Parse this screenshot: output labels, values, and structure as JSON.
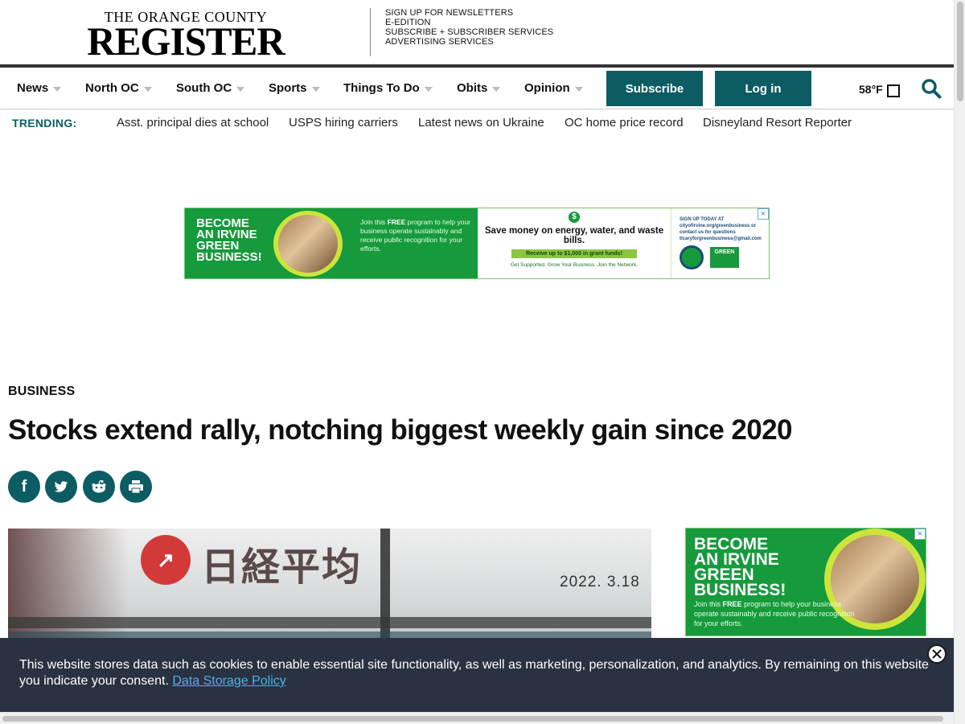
{
  "masthead": {
    "logo_small": "THE ORANGE COUNTY",
    "logo_big": "REGISTER",
    "links": [
      "SIGN UP FOR NEWSLETTERS",
      "E-EDITION",
      "SUBSCRIBE + SUBSCRIBER SERVICES",
      "ADVERTISING SERVICES"
    ]
  },
  "nav": {
    "items": [
      "News",
      "North OC",
      "South OC",
      "Sports",
      "Things To Do",
      "Obits",
      "Opinion"
    ],
    "subscribe_label": "Subscribe",
    "login_label": "Log in",
    "weather": "58°F",
    "search_icon": "search-icon",
    "accent_color": "#0d5c63"
  },
  "trending": {
    "label": "TRENDING:",
    "links": [
      "Asst. principal dies at school",
      "USPS hiring carriers",
      "Latest news on Ukraine",
      "OC home price record",
      "Disneyland Resort Reporter"
    ]
  },
  "ad_top": {
    "headline": [
      "BECOME",
      "AN IRVINE",
      "GREEN",
      "BUSINESS!"
    ],
    "blurb_pre": "Join this",
    "blurb_bold": "FREE",
    "blurb_post": "program to help your business operate sustainably and receive public recognition for your efforts.",
    "save_text": "Save money on energy, water, and waste bills.",
    "grant_text": "Receive up to $1,000 in grant funds!",
    "tagline": "Get Supported. Grow Your Business. Join the Network.",
    "signup": "SIGN UP TODAY AT cityofirvine.org/greenbusiness or contact us for questions tlcaryforgreenbusiness@gmail.com",
    "green_logo": "GREEN",
    "close": "×"
  },
  "article": {
    "section": "BUSINESS",
    "headline": "Stocks extend rally, notching biggest weekly gain since 2020",
    "share_icons": [
      "facebook-icon",
      "twitter-icon",
      "reddit-icon",
      "print-icon"
    ],
    "image": {
      "kanji": "日経平均",
      "date": "2022. 3.18"
    }
  },
  "ad_side": {
    "headline": [
      "BECOME",
      "AN IRVINE",
      "GREEN",
      "BUSINESS!"
    ],
    "blurb_pre": "Join this",
    "blurb_bold": "FREE",
    "blurb_post": "program to help your business operate sustainably and receive public recognition for your efforts.",
    "close": "×"
  },
  "cookie": {
    "text": "This website stores data such as cookies to enable essential site functionality, as well as marketing, personalization, and analytics. By remaining on this website you indicate your consent.",
    "link": "Data Storage Policy"
  }
}
